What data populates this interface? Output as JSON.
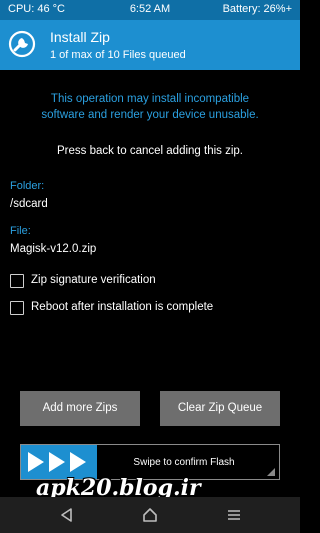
{
  "status_bar": {
    "cpu": "CPU: 46 °C",
    "time": "6:52 AM",
    "battery": "Battery: 26%+"
  },
  "header": {
    "title": "Install Zip",
    "subtitle": "1 of max of 10 Files queued",
    "icon": "twrp-logo-icon"
  },
  "warning": {
    "line1": "This operation may install incompatible",
    "line2": "software and render your device unusable."
  },
  "press_back": "Press back to cancel adding this zip.",
  "folder": {
    "label": "Folder:",
    "value": "/sdcard"
  },
  "file": {
    "label": "File:",
    "value": "Magisk-v12.0.zip"
  },
  "options": [
    {
      "label": "Zip signature verification",
      "checked": false
    },
    {
      "label": "Reboot after installation is complete",
      "checked": false
    }
  ],
  "buttons": {
    "add_more": "Add more Zips",
    "clear_queue": "Clear Zip Queue"
  },
  "slider": {
    "label": "Swipe to confirm Flash",
    "icon": "triple-arrow-icon"
  },
  "navbar": {
    "back_icon": "back-triangle-icon",
    "home_icon": "home-icon",
    "menu_icon": "menu-icon"
  },
  "watermark": "apk20.blog.ir",
  "colors": {
    "status_bar": "#0f6fa6",
    "header": "#1d8fd0",
    "accent_text": "#2ba0e0",
    "button": "#6e6e6e",
    "navbar": "#1f1f1f"
  }
}
